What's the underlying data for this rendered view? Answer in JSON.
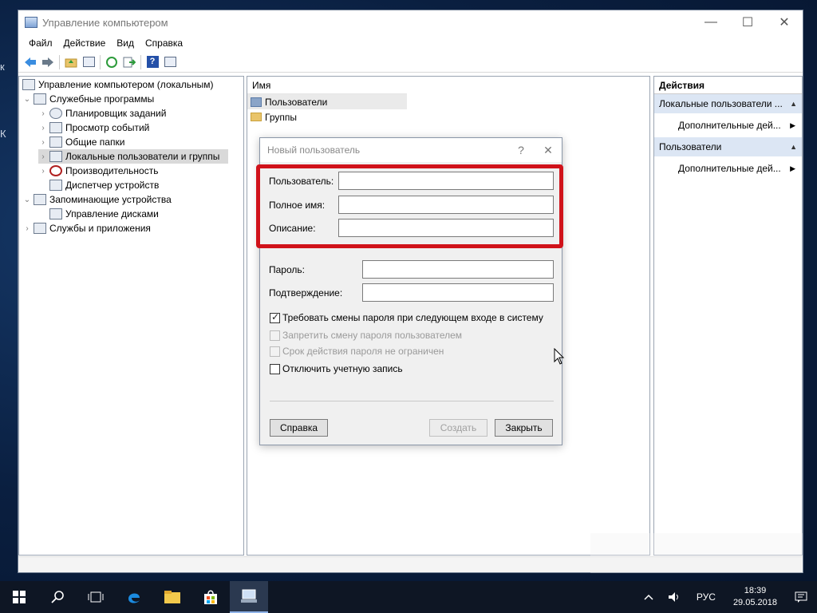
{
  "window": {
    "title": "Управление компьютером",
    "controls": [
      "—",
      "☐",
      "✕"
    ]
  },
  "menu": [
    "Файл",
    "Действие",
    "Вид",
    "Справка"
  ],
  "tree": {
    "root": "Управление компьютером (локальным)",
    "items": [
      {
        "label": "Служебные программы"
      },
      {
        "label": "Планировщик заданий"
      },
      {
        "label": "Просмотр событий"
      },
      {
        "label": "Общие папки"
      },
      {
        "label": "Локальные пользователи и группы"
      },
      {
        "label": "Производительность"
      },
      {
        "label": "Диспетчер устройств"
      },
      {
        "label": "Запоминающие устройства"
      },
      {
        "label": "Управление дисками"
      },
      {
        "label": "Службы и приложения"
      }
    ]
  },
  "center": {
    "column_header": "Имя",
    "rows": [
      "Пользователи",
      "Группы"
    ]
  },
  "actions": {
    "header": "Действия",
    "sections": [
      {
        "title": "Локальные пользователи ...",
        "item": "Дополнительные дей..."
      },
      {
        "title": "Пользователи",
        "item": "Дополнительные дей..."
      }
    ]
  },
  "dialog": {
    "title": "Новый пользователь",
    "help": "?",
    "close": "✕",
    "fields": {
      "user": {
        "label": "Пользователь:",
        "value": ""
      },
      "fullname": {
        "label": "Полное имя:",
        "value": ""
      },
      "description": {
        "label": "Описание:",
        "value": ""
      },
      "password": {
        "label": "Пароль:",
        "value": ""
      },
      "confirm": {
        "label": "Подтверждение:",
        "value": ""
      }
    },
    "checkboxes": {
      "require_change": "Требовать смены пароля при следующем входе в систему",
      "forbid_change": "Запретить смену пароля пользователем",
      "never_expires": "Срок действия пароля не ограничен",
      "disable_account": "Отключить учетную запись"
    },
    "buttons": {
      "help": "Справка",
      "create": "Создать",
      "close": "Закрыть"
    }
  },
  "taskbar": {
    "lang": "РУС",
    "time": "18:39",
    "date": "29.05.2018"
  },
  "colors": {
    "highlight_frame": "#d0121a",
    "accent_section": "#dce6f4"
  }
}
